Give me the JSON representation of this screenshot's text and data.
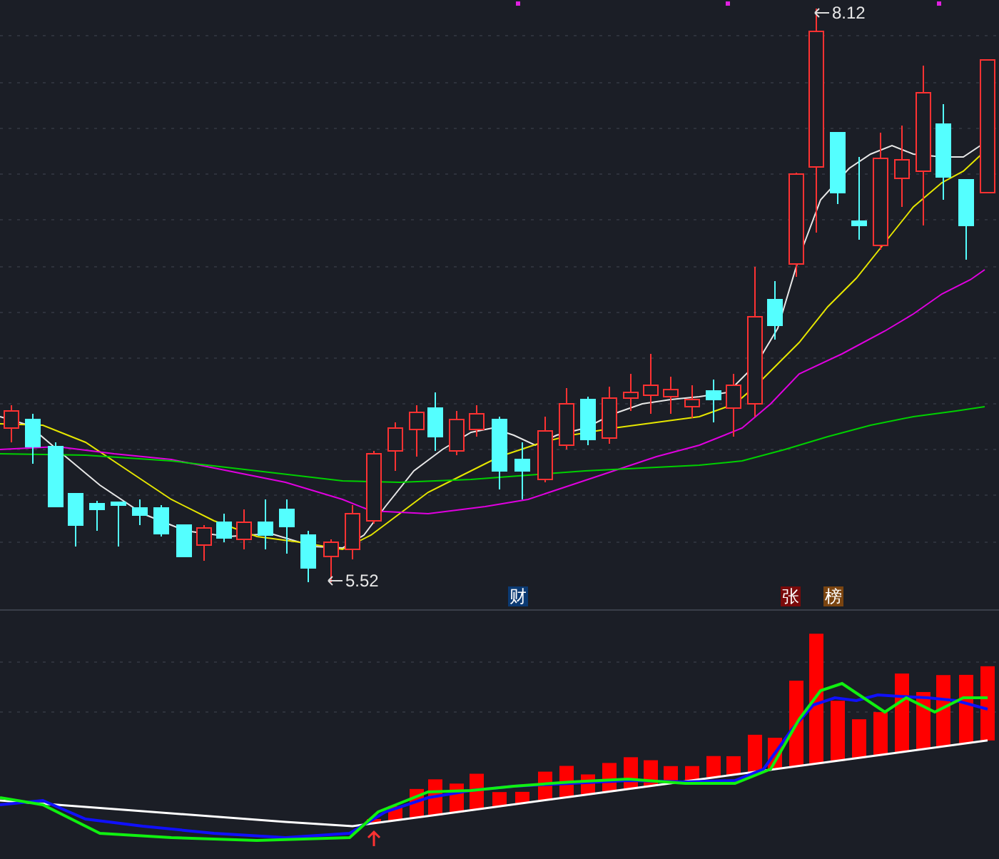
{
  "price_chart": {
    "high_label": "8.12",
    "low_label": "5.52"
  },
  "event_markers": [
    {
      "text": "财",
      "color": "#0b3a73"
    },
    {
      "text": "张",
      "color": "#7a0a0a"
    },
    {
      "text": "榜",
      "color": "#7a4410"
    }
  ]
}
